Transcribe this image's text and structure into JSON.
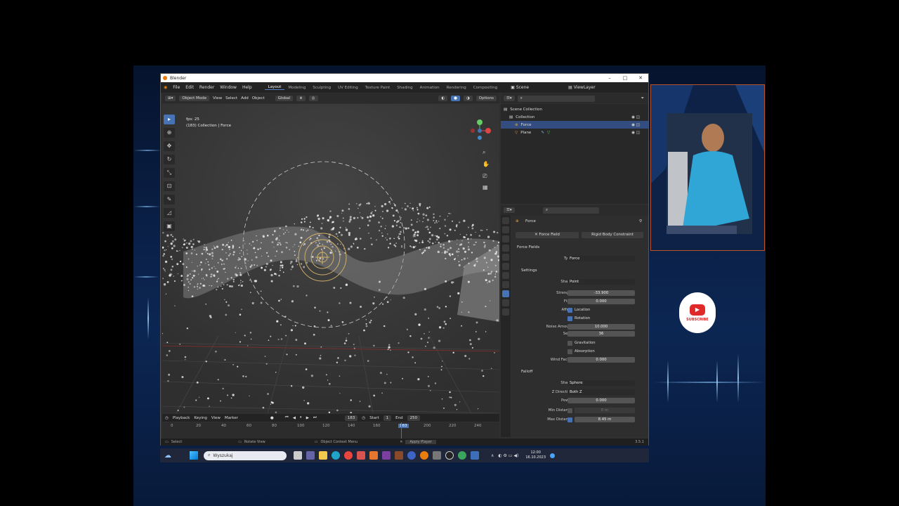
{
  "window": {
    "title": "Blender"
  },
  "menu": {
    "items": [
      "File",
      "Edit",
      "Render",
      "Window",
      "Help"
    ]
  },
  "workspaces": [
    "Layout",
    "Modeling",
    "Sculpting",
    "UV Editing",
    "Texture Paint",
    "Shading",
    "Animation",
    "Rendering",
    "Compositing"
  ],
  "scene": {
    "label": "Scene",
    "view_layer": "ViewLayer"
  },
  "viewport_header": {
    "mode": "Object Mode",
    "menus": [
      "View",
      "Select",
      "Add",
      "Object"
    ],
    "orientation": "Global",
    "options": "Options"
  },
  "viewport_info": {
    "fps": "fps: 25",
    "context": "(183) Collection | Force"
  },
  "timeline": {
    "menus": [
      "Playback",
      "Keying",
      "View",
      "Marker"
    ],
    "current_frame": "183",
    "start_label": "Start",
    "start_value": "1",
    "end_label": "End",
    "end_value": "250",
    "ticks": [
      "0",
      "20",
      "40",
      "60",
      "80",
      "100",
      "120",
      "140",
      "160",
      "183",
      "200",
      "220",
      "240"
    ]
  },
  "statusbar": {
    "items": [
      "Select",
      "Rotate View",
      "Object Context Menu",
      "Apply Player"
    ],
    "version": "3.5.1"
  },
  "outliner": {
    "rows": [
      {
        "label": "Scene Collection",
        "selected": false
      },
      {
        "label": "Collection",
        "selected": false
      },
      {
        "label": "Force",
        "selected": true
      },
      {
        "label": "Plane",
        "selected": false
      }
    ]
  },
  "properties": {
    "object_name": "Force",
    "tabs": [
      "Force Field",
      "Rigid Body Constraint"
    ],
    "section_force_fields": "Force Fields",
    "type_label": "Type",
    "type_value": "Force",
    "section_settings": "Settings",
    "shape_label": "Shape",
    "shape_value": "Point",
    "strength_label": "Strength",
    "strength_value": "-33.900",
    "flow_label": "Flow",
    "flow_value": "0.000",
    "affect_label": "Affect",
    "affect_location": "Location",
    "affect_rotation": "Rotation",
    "noise_label": "Noise Amount",
    "noise_value": "10.000",
    "seed_label": "Seed",
    "seed_value": "36",
    "gravitation": "Gravitation",
    "absorption": "Absorption",
    "wind_label": "Wind Factor",
    "wind_value": "0.000",
    "section_falloff": "Falloff",
    "falloff_shape_label": "Shape",
    "falloff_shape_value": "Sphere",
    "zdir_label": "Z Direction",
    "zdir_value": "Both Z",
    "power_label": "Power",
    "power_value": "0.000",
    "min_dist_label": "Min Distance",
    "min_dist_value": "0 m",
    "max_dist_label": "Max Distance",
    "max_dist_value": "8.45 m"
  },
  "taskbar": {
    "search_placeholder": "Wyszukaj",
    "time": "12:00",
    "date": "16.10.2023"
  },
  "subscribe": {
    "label": "SUBSCRIBE"
  },
  "colors": {
    "accent": "#4772b3",
    "selection": "#334d80",
    "subscribe": "#e02a2a"
  }
}
